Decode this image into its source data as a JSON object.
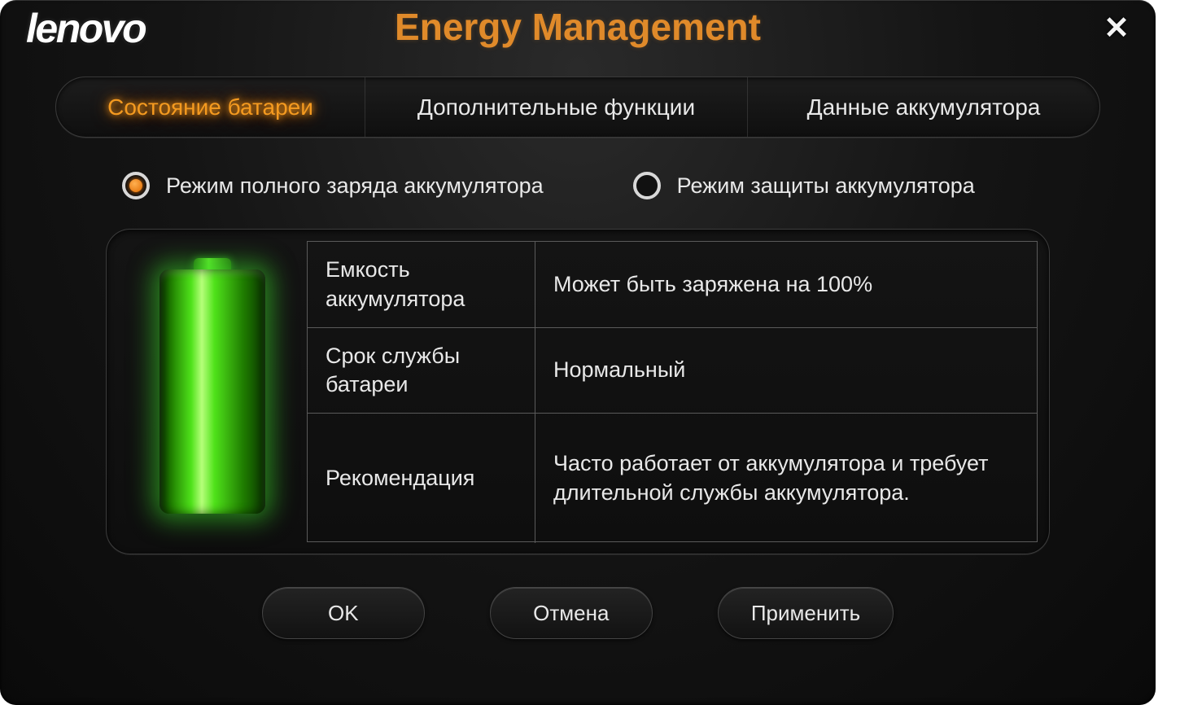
{
  "brand": "lenovo",
  "title": "Energy Management",
  "tabs": [
    {
      "label": "Состояние батареи",
      "active": true
    },
    {
      "label": "Дополнительные функции",
      "active": false
    },
    {
      "label": "Данные аккумулятора",
      "active": false
    }
  ],
  "modes": [
    {
      "label": "Режим полного заряда аккумулятора",
      "selected": true
    },
    {
      "label": "Режим защиты аккумулятора",
      "selected": false
    }
  ],
  "info": [
    {
      "key": "Емкость аккумулятора",
      "value": "Может быть заряжена на 100%"
    },
    {
      "key": "Срок службы батареи",
      "value": "Нормальный"
    },
    {
      "key": "Рекомендация",
      "value": "Часто работает от аккумулятора и требует длительной службы аккумулятора."
    }
  ],
  "buttons": {
    "ok": "OK",
    "cancel": "Отмена",
    "apply": "Применить"
  },
  "colors": {
    "accent": "#e08a2a",
    "battery": "#4fe21a"
  }
}
